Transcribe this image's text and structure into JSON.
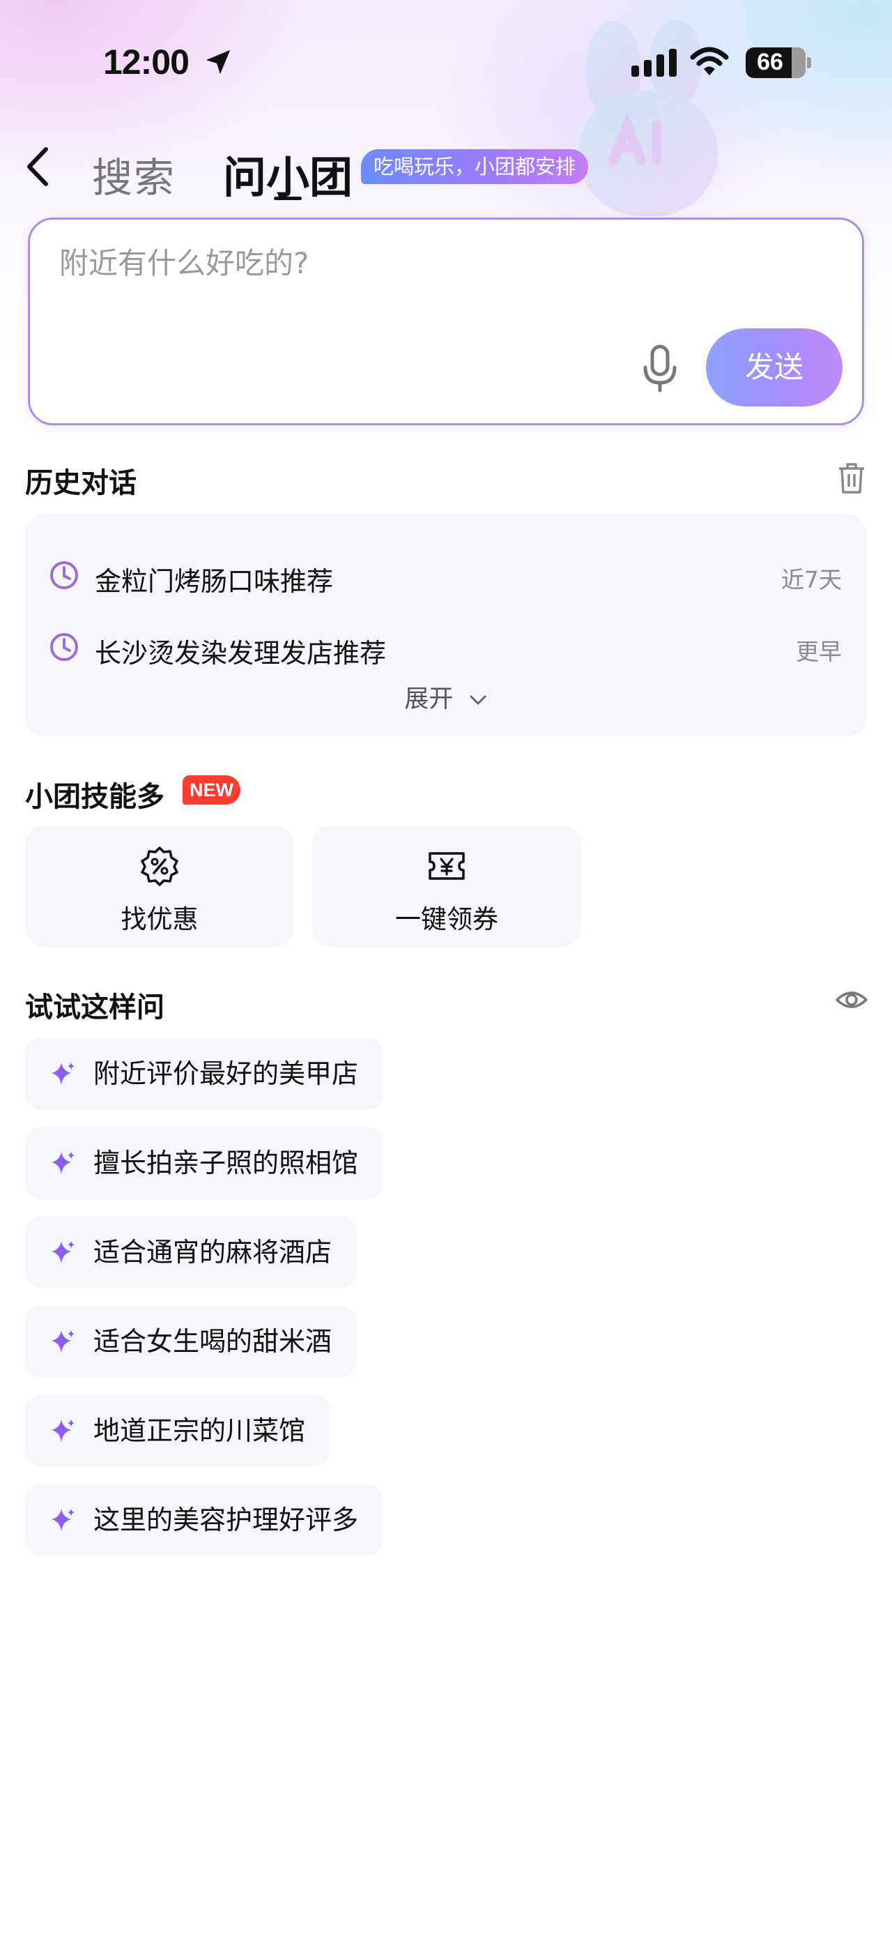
{
  "status_bar": {
    "time": "12:00",
    "battery": "66",
    "icons": [
      "location-arrow-icon",
      "signal-icon",
      "wifi-icon",
      "battery-icon"
    ]
  },
  "nav": {
    "back_icon": "back-arrow-icon",
    "tab_search": "搜索",
    "tab_ask": "问小团",
    "slogan": "吃喝玩乐，小团都安排"
  },
  "input": {
    "placeholder": "附近有什么好吃的?",
    "value": "",
    "mic_icon": "microphone-icon",
    "send_label": "发送"
  },
  "history": {
    "title": "历史对话",
    "delete_icon": "trash-icon",
    "items": [
      {
        "text": "金粒门烤肠口味推荐",
        "time": "近7天"
      },
      {
        "text": "长沙烫发染发理发店推荐",
        "time": "更早"
      }
    ],
    "expand_label": "展开"
  },
  "skills": {
    "title": "小团技能多",
    "badge": "NEW",
    "items": [
      {
        "label": "找优惠",
        "icon": "discount-percent-icon"
      },
      {
        "label": "一键领券",
        "icon": "coupon-yen-icon"
      }
    ]
  },
  "suggestions": {
    "title": "试试这样问",
    "visibility_icon": "eye-icon",
    "items": [
      "附近评价最好的美甲店",
      "擅长拍亲子照的照相馆",
      "适合通宵的麻将酒店",
      "适合女生喝的甜米酒",
      "地道正宗的川菜馆",
      "这里的美容护理好评多"
    ]
  },
  "colors": {
    "accent_purple": "#8b5cf6",
    "send_gradient_start": "#8ea2ff",
    "send_gradient_end": "#c08bf6",
    "badge_red": "#ff3b30",
    "card_bg": "#f5f6fa"
  }
}
